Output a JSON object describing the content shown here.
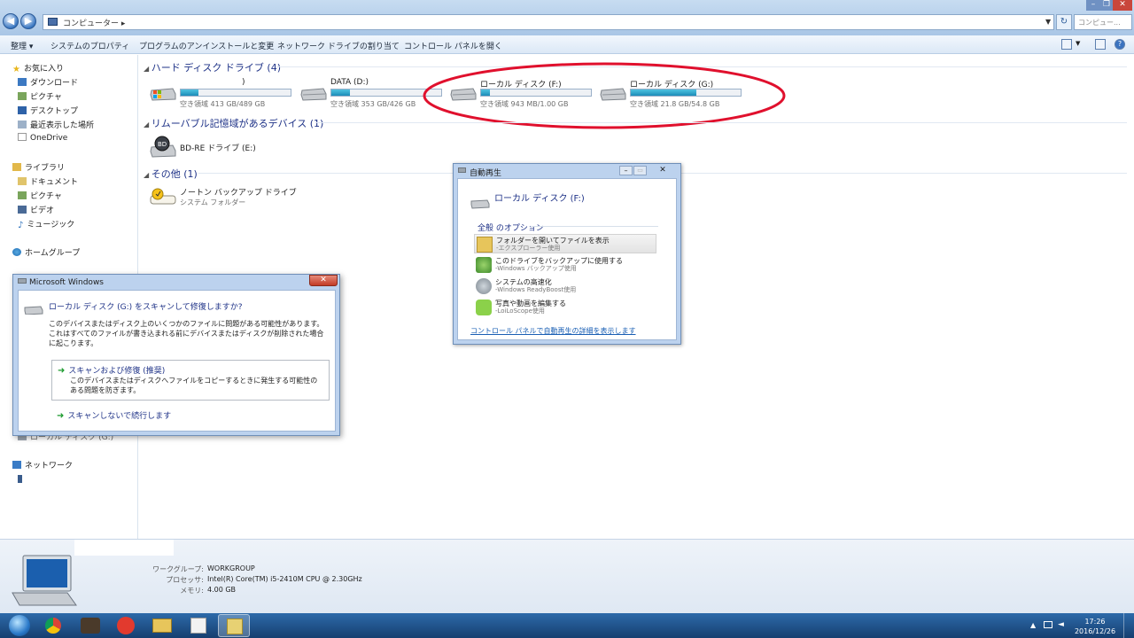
{
  "addressbar": {
    "path": "コンピューター",
    "search_placeholder": "コンピュー..."
  },
  "toolbar": {
    "organize": "整理 ▾",
    "system_properties": "システムのプロパティ",
    "uninstall": "プログラムのアンインストールと変更",
    "map_drive": "ネットワーク ドライブの割り当て",
    "control_panel": "コントロール パネルを開く"
  },
  "sidebar": {
    "favorites": "お気に入り",
    "fav_items": [
      "ダウンロード",
      "ピクチャ",
      "デスクトップ",
      "最近表示した場所",
      "OneDrive"
    ],
    "libraries": "ライブラリ",
    "lib_items": [
      "ドキュメント",
      "ピクチャ",
      "ビデオ",
      "ミュージック"
    ],
    "homegroup": "ホームグループ",
    "hidden_partial": "ローカル ディスク (G:)",
    "network": "ネットワーク"
  },
  "main": {
    "hdd_group": "ハード ディスク ドライブ (4)",
    "drives": [
      {
        "name": ")",
        "free": "空き領域 413 GB/489 GB",
        "used_fraction": 0.16
      },
      {
        "name": "DATA (D:)",
        "free": "空き領域 353 GB/426 GB",
        "used_fraction": 0.17
      },
      {
        "name": "ローカル ディスク (F:)",
        "free": "空き領域 943 MB/1.00 GB",
        "used_fraction": 0.08
      },
      {
        "name": "ローカル ディスク (G:)",
        "free": "空き領域 21.8 GB/54.8 GB",
        "used_fraction": 0.6
      }
    ],
    "removable_group": "リムーバブル記憶域があるデバイス (1)",
    "bd_drive": "BD-RE ドライブ (E:)",
    "other_group": "その他 (1)",
    "norton_name": "ノートン バックアップ ドライブ",
    "norton_type": "システム フォルダー"
  },
  "autoplay": {
    "title": "自動再生",
    "drive": "ローカル ディスク (F:)",
    "section": "全般 のオプション",
    "options": [
      {
        "title": "フォルダーを開いてファイルを表示",
        "sub": "-エクスプローラー使用"
      },
      {
        "title": "このドライブをバックアップに使用する",
        "sub": "-Windows バックアップ使用"
      },
      {
        "title": "システムの高速化",
        "sub": "-Windows ReadyBoost使用"
      },
      {
        "title": "写真や動画を編集する",
        "sub": "-LoiLoScope使用"
      }
    ],
    "link": "コントロール パネルで自動再生の詳細を表示します"
  },
  "msdialog": {
    "title": "Microsoft Windows",
    "heading": "ローカル ディスク (G:) をスキャンして修復しますか?",
    "body": "このデバイスまたはディスク上のいくつかのファイルに問題がある可能性があります。これはすべてのファイルが書き込まれる前にデバイスまたはディスクが削除された場合に起こります。",
    "option1_title": "スキャンおよび修復 (推奨)",
    "option1_desc": "このデバイスまたはディスクへファイルをコピーするときに発生する可能性のある問題を防ぎます。",
    "option2_title": "スキャンしないで続行します"
  },
  "details": {
    "workgroup_label": "ワークグループ:",
    "workgroup_value": "WORKGROUP",
    "cpu_label": "プロセッサ:",
    "cpu_value": "Intel(R) Core(TM) i5-2410M CPU @ 2.30GHz",
    "mem_label": "メモリ:",
    "mem_value": "4.00 GB"
  },
  "taskbar": {
    "time": "17:26",
    "date": "2016/12/26"
  },
  "colors": {
    "annotation_ellipse": "#e0102d",
    "link": "#1a5fb4",
    "group_header": "#1e3287"
  }
}
